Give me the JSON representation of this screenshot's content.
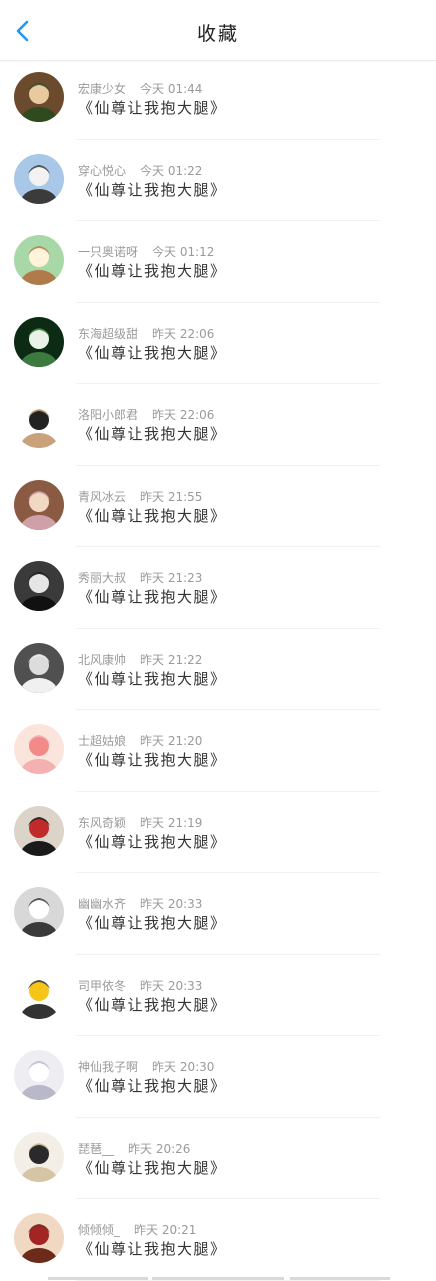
{
  "header": {
    "title": "收藏"
  },
  "items": [
    {
      "name": "宏康少女",
      "time": "今天 01:44",
      "message": "《仙尊让我抱大腿》",
      "avatar": {
        "bg": "#6b4a2e",
        "fg": "#e8c9a0",
        "accent": "#2f4a1f"
      }
    },
    {
      "name": "穿心悦心",
      "time": "今天 01:22",
      "message": "《仙尊让我抱大腿》",
      "avatar": {
        "bg": "#a9c7e6",
        "fg": "#f2f2f2",
        "accent": "#3b3b3b"
      }
    },
    {
      "name": "一只奥诺呀",
      "time": "今天 01:12",
      "message": "《仙尊让我抱大腿》",
      "avatar": {
        "bg": "#a8d8a8",
        "fg": "#fff3d9",
        "accent": "#b07a4a"
      }
    },
    {
      "name": "东海超级甜",
      "time": "昨天 22:06",
      "message": "《仙尊让我抱大腿》",
      "avatar": {
        "bg": "#0d2b14",
        "fg": "#e9f2e9",
        "accent": "#3d7a3d"
      }
    },
    {
      "name": "洛阳小郎君",
      "time": "昨天 22:06",
      "message": "《仙尊让我抱大腿》",
      "avatar": {
        "bg": "#ffffff",
        "fg": "#222222",
        "accent": "#c9a17a"
      }
    },
    {
      "name": "青风冰云",
      "time": "昨天 21:55",
      "message": "《仙尊让我抱大腿》",
      "avatar": {
        "bg": "#8a5a42",
        "fg": "#f1d8c2",
        "accent": "#d0a0a8"
      }
    },
    {
      "name": "秀丽大叔",
      "time": "昨天 21:23",
      "message": "《仙尊让我抱大腿》",
      "avatar": {
        "bg": "#3a3a3a",
        "fg": "#e6e6e6",
        "accent": "#111111"
      }
    },
    {
      "name": "北风康帅",
      "time": "昨天 21:22",
      "message": "《仙尊让我抱大腿》",
      "avatar": {
        "bg": "#505050",
        "fg": "#dcdcdc",
        "accent": "#f0f0f0"
      }
    },
    {
      "name": "士超姑娘",
      "time": "昨天 21:20",
      "message": "《仙尊让我抱大腿》",
      "avatar": {
        "bg": "#fbe4dc",
        "fg": "#f28a8a",
        "accent": "#f5b0b0"
      }
    },
    {
      "name": "东风奇颖",
      "time": "昨天 21:19",
      "message": "《仙尊让我抱大腿》",
      "avatar": {
        "bg": "#dcd4c8",
        "fg": "#c02a2a",
        "accent": "#1a1a1a"
      }
    },
    {
      "name": "幽幽水齐",
      "time": "昨天 20:33",
      "message": "《仙尊让我抱大腿》",
      "avatar": {
        "bg": "#d8d8d8",
        "fg": "#ffffff",
        "accent": "#3a3a3a"
      }
    },
    {
      "name": "司甲依冬",
      "time": "昨天 20:33",
      "message": "《仙尊让我抱大腿》",
      "avatar": {
        "bg": "#ffffff",
        "fg": "#f5c518",
        "accent": "#333333"
      }
    },
    {
      "name": "神仙我子啊",
      "time": "昨天 20:30",
      "message": "《仙尊让我抱大腿》",
      "avatar": {
        "bg": "#eeeef2",
        "fg": "#ffffff",
        "accent": "#b8b8c8"
      }
    },
    {
      "name": "琵琶__",
      "time": "昨天 20:26",
      "message": "《仙尊让我抱大腿》",
      "avatar": {
        "bg": "#f4efe6",
        "fg": "#2a2a2a",
        "accent": "#d7c4a5"
      }
    },
    {
      "name": "倾倾倾_",
      "time": "昨天 20:21",
      "message": "《仙尊让我抱大腿》",
      "avatar": {
        "bg": "#f1d8c2",
        "fg": "#a32424",
        "accent": "#6b2a1a"
      }
    }
  ],
  "theme": {
    "accent": "#2196f3",
    "meta_color": "#9a9a9a"
  }
}
